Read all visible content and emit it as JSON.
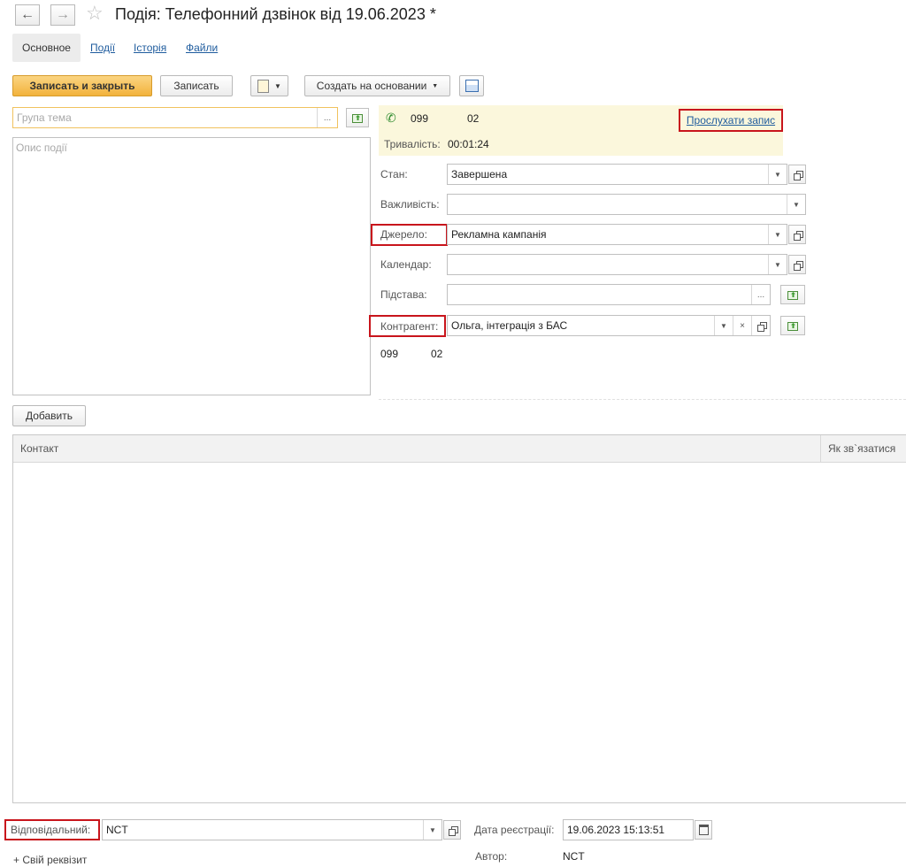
{
  "header": {
    "title": "Подія: Телефонний дзвінок від 19.06.2023 *"
  },
  "tabs": [
    {
      "label": "Основное"
    },
    {
      "label": "Події"
    },
    {
      "label": "Історія"
    },
    {
      "label": "Файли"
    }
  ],
  "toolbar": {
    "save_close": "Записать и закрыть",
    "save": "Записать",
    "create_based": "Создать на основании"
  },
  "form": {
    "subject_placeholder": "Група тема",
    "description_placeholder": "Опис події",
    "call_phone": "099",
    "call_phone_suffix": "02",
    "listen_link": "Прослухати запис",
    "duration_label": "Тривалість:",
    "duration_value": "00:01:24",
    "state_label": "Стан:",
    "state_value": "Завершена",
    "importance_label": "Важливість:",
    "importance_value": "",
    "source_label": "Джерело:",
    "source_value": "Рекламна кампанія",
    "calendar_label": "Календар:",
    "calendar_value": "",
    "basis_label": "Підстава:",
    "basis_value": "",
    "counterparty_label": "Контрагент:",
    "counterparty_value": "Ольга, інтеграція з БАС",
    "counterparty_phone": "099",
    "counterparty_phone_suffix": "02"
  },
  "contacts": {
    "add_button": "Добавить",
    "columns": [
      "Контакт",
      "Як зв`язатися"
    ]
  },
  "footer": {
    "responsible_label": "Відповідальний:",
    "responsible_value": "NCT",
    "reg_date_label": "Дата реєстрації:",
    "reg_date_value": "19.06.2023 15:13:51",
    "author_label": "Автор:",
    "author_value": "NCT",
    "custom_attr": "+ Свій реквізит"
  },
  "icons": {
    "back": "arrow-left-icon",
    "forward": "arrow-right-icon",
    "star": "star-icon",
    "phone": "phone-icon",
    "report": "report-icon",
    "structure": "structure-icon",
    "calendar": "calendar-icon"
  },
  "colors": {
    "accent_button": "#f2b23c",
    "call_panel": "#fbf7dc",
    "highlight_border": "#c8151c",
    "link": "#1f5c9e",
    "focus_border": "#f0c25e"
  }
}
